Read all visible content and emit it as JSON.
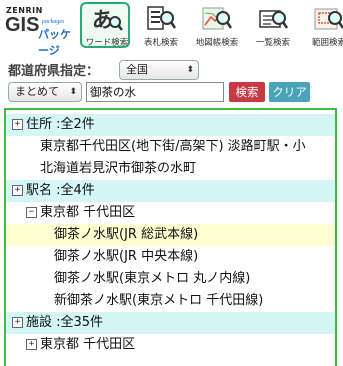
{
  "logo": {
    "brand": "ZENRIN",
    "gis": "GIS",
    "packages": "packages",
    "product": "パッケージ"
  },
  "toolbar": [
    {
      "label": "ワード検索",
      "icon": "word-search-icon",
      "active": true
    },
    {
      "label": "表札検索",
      "icon": "nameplate-search-icon",
      "active": false
    },
    {
      "label": "地図帳検索",
      "icon": "atlas-search-icon",
      "active": false
    },
    {
      "label": "一覧検索",
      "icon": "list-search-icon",
      "active": false
    },
    {
      "label": "範囲検索",
      "icon": "range-search-icon",
      "active": false
    }
  ],
  "filters": {
    "prefecture_label": "都道府県指定：",
    "prefecture_value": "全国",
    "grouping_value": "まとめて",
    "query": "御茶の水",
    "search_label": "検索",
    "clear_label": "クリア"
  },
  "results": [
    {
      "text": "住所 :全2件",
      "kind": "category",
      "toggle": "+"
    },
    {
      "text": "東京都千代田区(地下街/高架下) 淡路町駅・小",
      "kind": "item"
    },
    {
      "text": "北海道岩見沢市御茶の水町",
      "kind": "item"
    },
    {
      "text": "駅名 :全4件",
      "kind": "category",
      "toggle": "+"
    },
    {
      "text": "東京都 千代田区",
      "kind": "group",
      "toggle": "−"
    },
    {
      "text": "御茶ノ水駅(JR 総武本線)",
      "kind": "subitem",
      "selected": true
    },
    {
      "text": "御茶ノ水駅(JR 中央本線)",
      "kind": "subitem"
    },
    {
      "text": "御茶ノ水駅(東京メトロ 丸ノ内線)",
      "kind": "subitem"
    },
    {
      "text": "新御茶ノ水駅(東京メトロ 千代田線)",
      "kind": "subitem"
    },
    {
      "text": "施設 :全35件",
      "kind": "category",
      "toggle": "+"
    },
    {
      "text": "東京都 千代田区",
      "kind": "group",
      "toggle": "+"
    }
  ],
  "colors": {
    "accent_green": "#3fbb3f",
    "category_bg": "#d4f6f6",
    "selected_bg": "#ffffd2",
    "search_btn": "#c73a45",
    "clear_btn": "#4aa3b8"
  }
}
